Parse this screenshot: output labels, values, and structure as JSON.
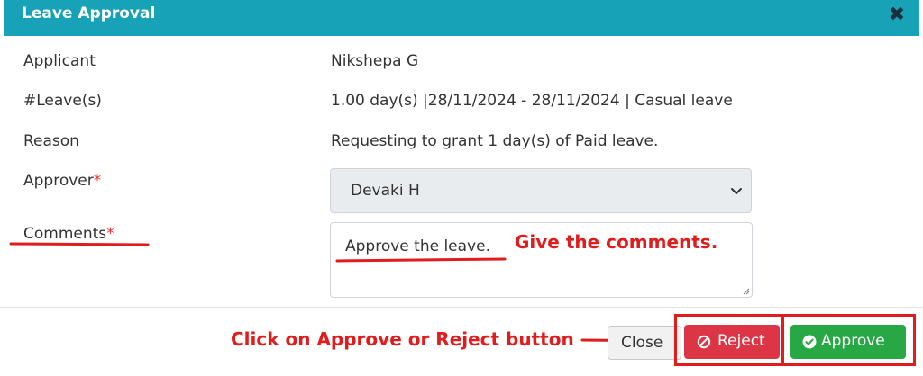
{
  "dialog": {
    "title": "Leave Approval",
    "close_glyph": "✖"
  },
  "fields": {
    "applicant_label": "Applicant",
    "applicant_value": "Nikshepa G",
    "leaves_label": "#Leave(s)",
    "leaves_value": "1.00 day(s) |28/11/2024 - 28/11/2024 | Casual leave",
    "reason_label": "Reason",
    "reason_value": "Requesting to grant 1 day(s) of Paid leave.",
    "approver_label": "Approver",
    "approver_selected": "Devaki H",
    "comments_label": "Comments",
    "comments_value": "Approve the leave.",
    "required_mark": "*"
  },
  "annotations": {
    "comments_hint": "Give the comments.",
    "button_hint": "Click on Approve or Reject button",
    "color": "#e01c1c"
  },
  "buttons": {
    "close_label": "Close",
    "reject_label": "Reject",
    "approve_label": "Approve"
  },
  "colors": {
    "header": "#17a2b8",
    "reject": "#dc3545",
    "approve": "#28a745"
  },
  "icons": {
    "dialog_close": "close-icon",
    "select_arrow": "chevron-down-icon",
    "reject": "ban-icon",
    "approve": "check-circle-icon"
  }
}
